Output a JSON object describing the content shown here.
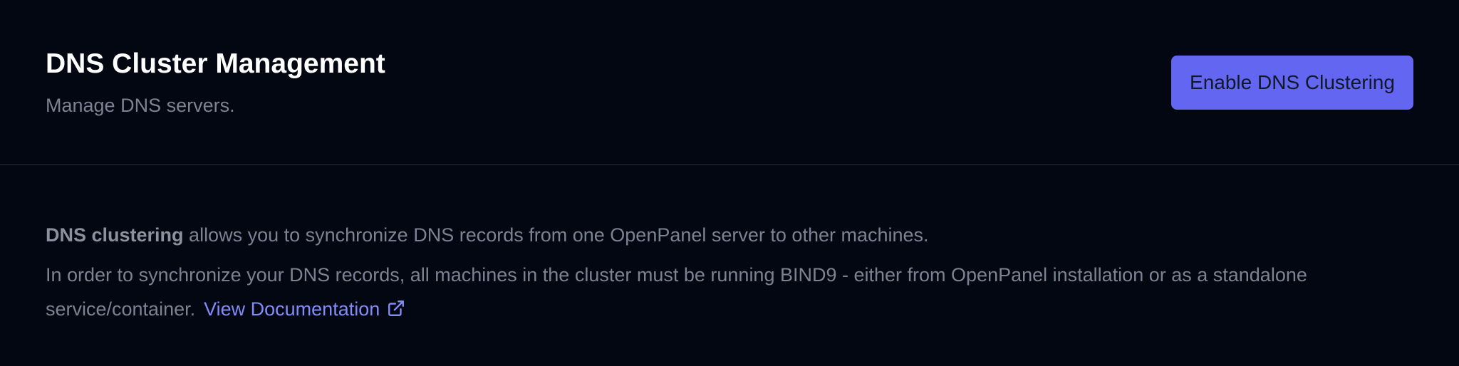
{
  "header": {
    "title": "DNS Cluster Management",
    "subtitle": "Manage DNS servers.",
    "enable_button_label": "Enable DNS Clustering"
  },
  "intro": {
    "bold_term": "DNS clustering",
    "sentence_rest": " allows you to synchronize DNS records from one OpenPanel server to other machines.",
    "requirement": "In order to synchronize your DNS records, all machines in the cluster must be running BIND9 - either from OpenPanel installation or as a standalone service/container.",
    "doc_link_label": "View Documentation"
  },
  "icons": {
    "doc_link_icon": "external-link-icon"
  },
  "colors": {
    "background": "#030712",
    "accent": "#6366f1",
    "link": "#818cf8",
    "muted_text": "#7b8292",
    "divider": "#2a2f3a"
  }
}
